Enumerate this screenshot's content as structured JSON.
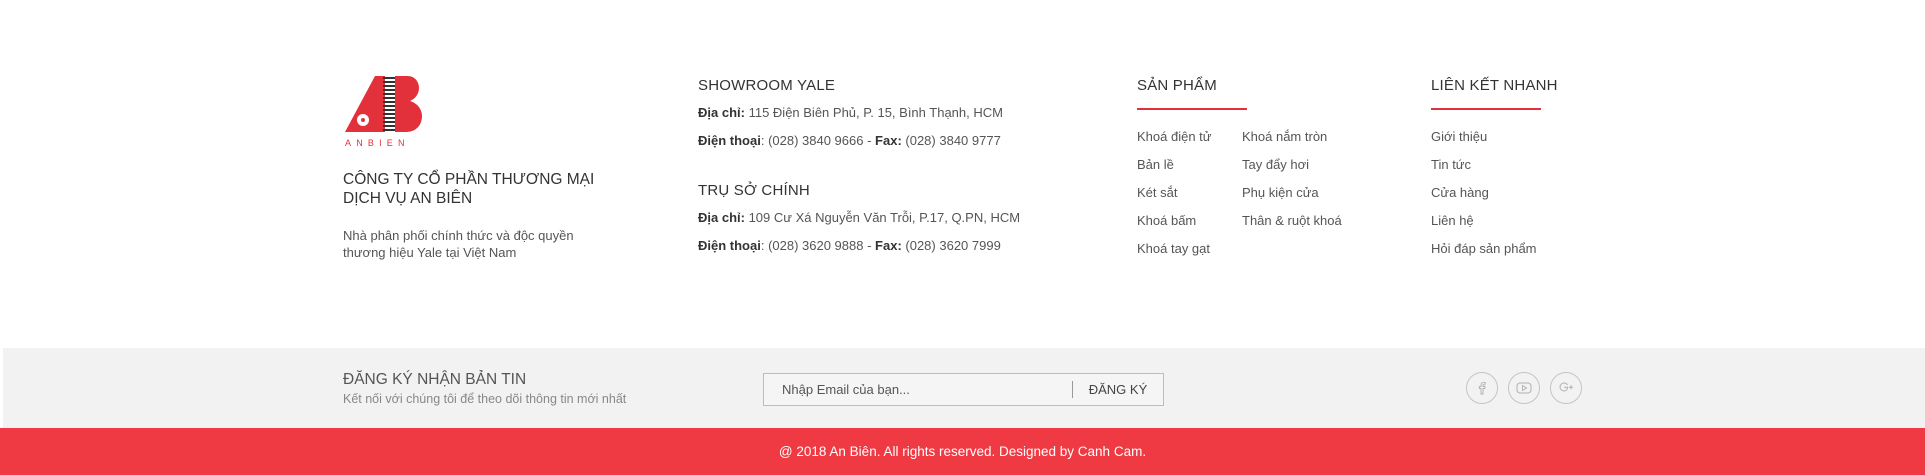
{
  "brand": {
    "logo_text": "ANBIEN",
    "logo_letter_a": "A",
    "logo_letter_b": "B",
    "company_name": "CÔNG TY CỔ PHẦN THƯƠNG MẠI DỊCH VỤ AN BIÊN",
    "description": "Nhà phân phối chính thức và độc quyền thương hiệu Yale tại Việt Nam",
    "accent_color": "#e3313c"
  },
  "contact": {
    "showroom": {
      "title": "SHOWROOM YALE",
      "address_label": "Địa chỉ:",
      "address": " 115 Điện Biên Phủ, P. 15, Bình Thạnh, HCM",
      "phone_label": "Điện thoại",
      "phone": ": (028) 3840 9666 -  ",
      "fax_label": "Fax:",
      "fax": " (028) 3840 9777"
    },
    "headquarters": {
      "title": "TRỤ SỞ CHÍNH",
      "address_label": "Địa chỉ:",
      "address": " 109 Cư Xá Nguyễn Văn Trỗi, P.17, Q.PN, HCM",
      "phone_label": "Điện thoại",
      "phone": ": (028) 3620 9888  -  ",
      "fax_label": "Fax:",
      "fax": " (028) 3620 7999"
    }
  },
  "products": {
    "title": "SẢN PHẨM",
    "col1": [
      "Khoá điện tử",
      "Bản lề",
      "Két sắt",
      "Khoá bấm",
      "Khoá tay gạt"
    ],
    "col2": [
      "Khoá nắm tròn",
      "Tay đẩy hơi",
      "Phụ kiện cửa",
      "Thân & ruột khoá"
    ]
  },
  "quick_links": {
    "title": "LIÊN KẾT NHANH",
    "items": [
      "Giới thiệu",
      "Tin tức",
      "Cửa hàng",
      "Liên hệ",
      "Hỏi đáp sản phẩm"
    ]
  },
  "newsletter": {
    "title": "ĐĂNG KÝ NHẬN BẢN TIN",
    "subtitle": "Kết nối với chúng tôi để theo dõi thông tin mới nhất",
    "placeholder": "Nhập Email của bạn...",
    "button_label": "ĐĂNG KÝ",
    "background": "#f2f2f2"
  },
  "social": [
    {
      "name": "facebook-icon"
    },
    {
      "name": "youtube-icon"
    },
    {
      "name": "google-plus-icon"
    }
  ],
  "footer": {
    "copyright": "@ 2018 An Biên. All rights reserved. Designed by Canh Cam.",
    "background": "#ef3a43"
  }
}
